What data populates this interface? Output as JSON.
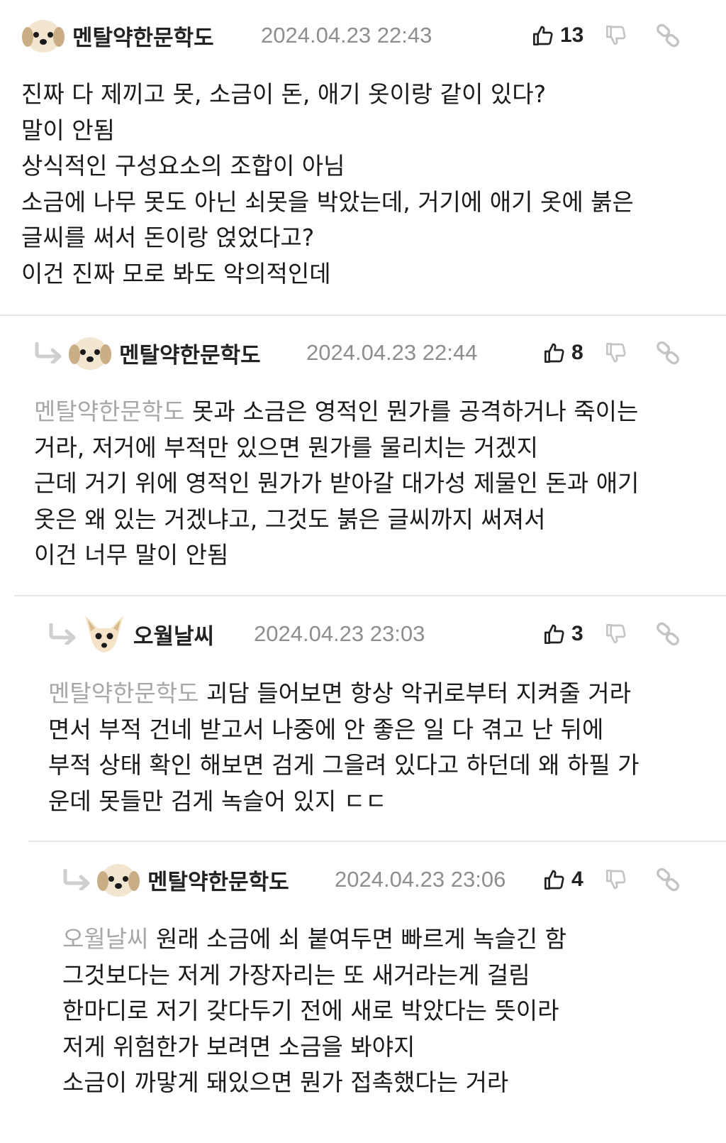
{
  "comments": [
    {
      "nickname": "멘탈약한문학도",
      "date": "2024.04.23 22:43",
      "likes": "13",
      "mention": "",
      "lines": [
        "진짜 다 제끼고 못, 소금이 돈, 애기 옷이랑 같이 있다?",
        "말이 안됨",
        "상식적인 구성요소의 조합이 아님",
        "소금에 나무 못도 아닌 쇠못을 박았는데, 거기에 애기 옷에 붉은",
        "글씨를 써서 돈이랑 얹었다고?",
        "이건 진짜 모로 봐도 악의적인데"
      ]
    },
    {
      "nickname": "멘탈약한문학도",
      "date": "2024.04.23 22:44",
      "likes": "8",
      "mention": "멘탈약한문학도",
      "lines": [
        "못과 소금은 영적인 뭔가를 공격하거나 죽이는",
        "거라, 저거에 부적만 있으면 뭔가를 물리치는 거겠지",
        "근데 거기 위에 영적인 뭔가가 받아갈 대가성 제물인 돈과 애기",
        "옷은 왜 있는 거겠냐고, 그것도 붉은 글씨까지 써져서",
        "이건 너무 말이 안됨"
      ]
    },
    {
      "nickname": "오월날씨",
      "date": "2024.04.23 23:03",
      "likes": "3",
      "mention": "멘탈약한문학도",
      "lines": [
        "괴담 들어보면 항상 악귀로부터 지켜줄 거라",
        "면서 부적 건네 받고서 나중에 안 좋은 일 다 겪고 난 뒤에",
        "부적 상태 확인 해보면 검게 그을려 있다고 하던데 왜 하필 가",
        "운데 못들만 검게 녹슬어 있지 ㄷㄷ"
      ]
    },
    {
      "nickname": "멘탈약한문학도",
      "date": "2024.04.23 23:06",
      "likes": "4",
      "mention": "오월날씨",
      "lines": [
        "원래 소금에 쇠 붙여두면 빠르게 녹슬긴 함",
        "그것보다는 저게 가장자리는 또 새거라는게 걸림",
        "한마디로 저기 갖다두기 전에 새로 박았다는 뜻이라",
        "저게 위험한가 보려면 소금을 봐야지",
        "소금이 까맣게 돼있으면 뭔가 접촉했다는 거라"
      ]
    }
  ]
}
